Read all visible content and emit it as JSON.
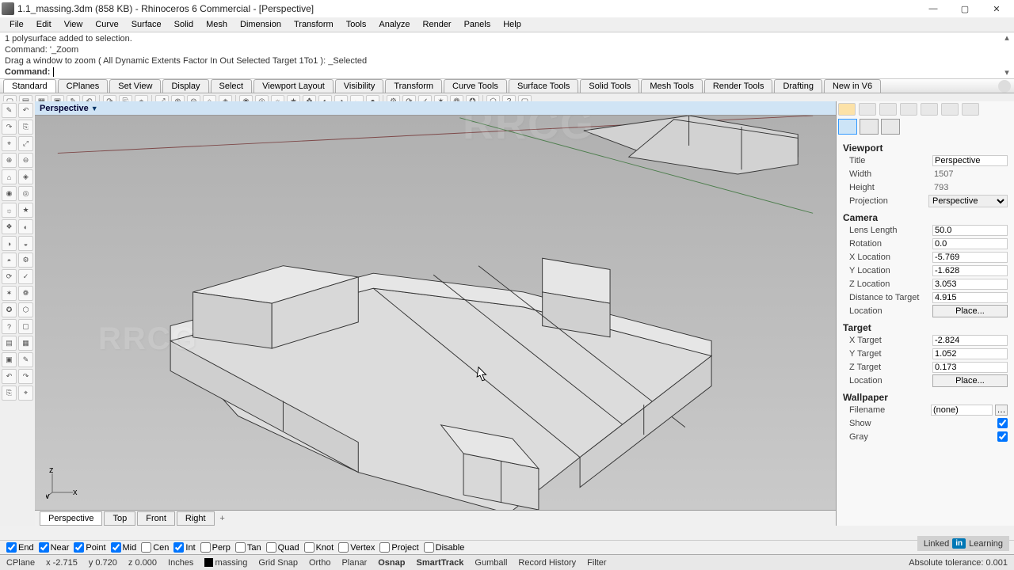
{
  "title": "1.1_massing.3dm (858 KB) - Rhinoceros 6 Commercial - [Perspective]",
  "menu": [
    "File",
    "Edit",
    "View",
    "Curve",
    "Surface",
    "Solid",
    "Mesh",
    "Dimension",
    "Transform",
    "Tools",
    "Analyze",
    "Render",
    "Panels",
    "Help"
  ],
  "cmd_history": [
    "1 polysurface added to selection.",
    "Command: '_Zoom",
    "Drag a window to zoom ( All  Dynamic  Extents  Factor  In  Out  Selected  Target  1To1 ): _Selected"
  ],
  "cmd_prompt": "Command:",
  "tab_toolbars": [
    "Standard",
    "CPlanes",
    "Set View",
    "Display",
    "Select",
    "Viewport Layout",
    "Visibility",
    "Transform",
    "Curve Tools",
    "Surface Tools",
    "Solid Tools",
    "Mesh Tools",
    "Render Tools",
    "Drafting",
    "New in V6"
  ],
  "viewport_name": "Perspective",
  "viewport_tabs": [
    "Perspective",
    "Top",
    "Front",
    "Right"
  ],
  "panel": {
    "viewport": {
      "header": "Viewport",
      "title_label": "Title",
      "title_val": "Perspective",
      "width_label": "Width",
      "width_val": "1507",
      "height_label": "Height",
      "height_val": "793",
      "proj_label": "Projection",
      "proj_val": "Perspective"
    },
    "camera": {
      "header": "Camera",
      "lens_label": "Lens Length",
      "lens_val": "50.0",
      "rot_label": "Rotation",
      "rot_val": "0.0",
      "x_label": "X Location",
      "x_val": "-5.769",
      "y_label": "Y Location",
      "y_val": "-1.628",
      "z_label": "Z Location",
      "z_val": "3.053",
      "dist_label": "Distance to Target",
      "dist_val": "4.915",
      "loc_label": "Location",
      "place": "Place..."
    },
    "target": {
      "header": "Target",
      "x_label": "X Target",
      "x_val": "-2.824",
      "y_label": "Y Target",
      "y_val": "1.052",
      "z_label": "Z Target",
      "z_val": "0.173",
      "loc_label": "Location",
      "place": "Place..."
    },
    "wallpaper": {
      "header": "Wallpaper",
      "file_label": "Filename",
      "file_val": "(none)",
      "show_label": "Show",
      "gray_label": "Gray"
    }
  },
  "osnap": [
    {
      "label": "End",
      "on": true
    },
    {
      "label": "Near",
      "on": true
    },
    {
      "label": "Point",
      "on": true
    },
    {
      "label": "Mid",
      "on": true
    },
    {
      "label": "Cen",
      "on": false
    },
    {
      "label": "Int",
      "on": true
    },
    {
      "label": "Perp",
      "on": false
    },
    {
      "label": "Tan",
      "on": false
    },
    {
      "label": "Quad",
      "on": false
    },
    {
      "label": "Knot",
      "on": false
    },
    {
      "label": "Vertex",
      "on": false
    },
    {
      "label": "Project",
      "on": false
    },
    {
      "label": "Disable",
      "on": false
    }
  ],
  "status": {
    "cplane": "CPlane",
    "x": "x -2.715",
    "y": "y 0.720",
    "z": "z 0.000",
    "units": "Inches",
    "layer": "massing",
    "gridsnap": "Grid Snap",
    "ortho": "Ortho",
    "planar": "Planar",
    "osnap": "Osnap",
    "smarttrack": "SmartTrack",
    "gumball": "Gumball",
    "record": "Record History",
    "filter": "Filter",
    "tol": "Absolute tolerance: 0.001"
  },
  "watermark_main": "RRCG",
  "linkedin": "Learning"
}
